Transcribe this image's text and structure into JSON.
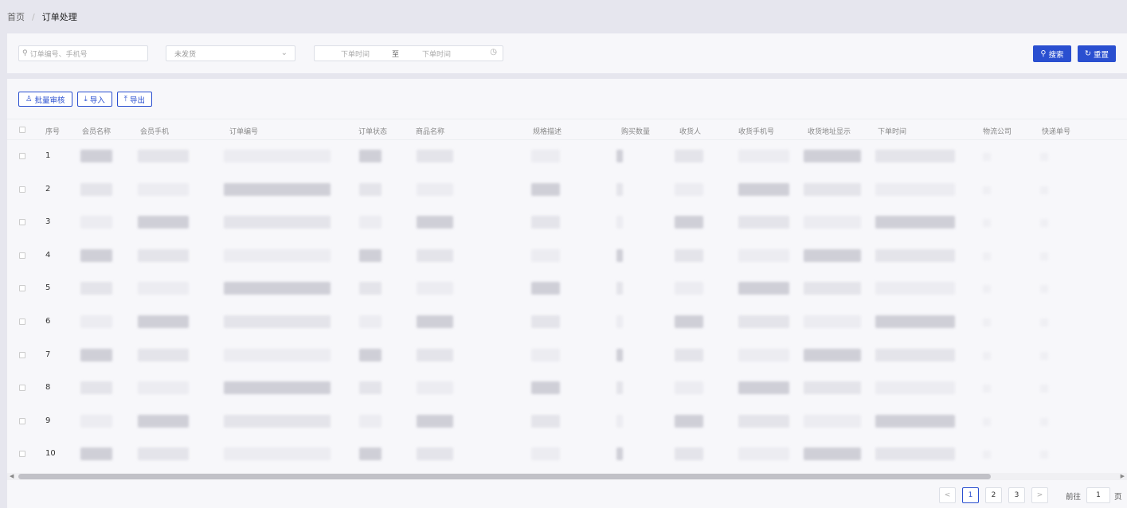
{
  "breadcrumb": {
    "home": "首页",
    "separator": "/",
    "current": "订单处理"
  },
  "filters": {
    "search_placeholder": "订单编号、手机号",
    "status_value": "未发货",
    "date_start": "下单时间",
    "date_separator": "至",
    "date_end": "下单时间",
    "search_button": "搜索",
    "reset_button": "重置"
  },
  "toolbar": {
    "batch_review": "批量审核",
    "import": "导入",
    "export": "导出"
  },
  "table": {
    "columns": [
      "序号",
      "会员名称",
      "会员手机",
      "订单编号",
      "订单状态",
      "商品名称",
      "规格描述",
      "购买数量",
      "收货人",
      "收货手机号",
      "收货地址显示",
      "下单时间",
      "物流公司",
      "快递单号"
    ],
    "rows": [
      "1",
      "2",
      "3",
      "4",
      "5",
      "6",
      "7",
      "8",
      "9",
      "10"
    ]
  },
  "pagination": {
    "prev": "<",
    "pages": [
      "1",
      "2",
      "3"
    ],
    "active_page": "1",
    "next": ">",
    "goto_label": "前往",
    "goto_value": "1",
    "page_suffix": "页"
  },
  "colors": {
    "primary": "#2a4fd0",
    "background": "#e6e6ee",
    "panel": "#f7f7fa"
  }
}
